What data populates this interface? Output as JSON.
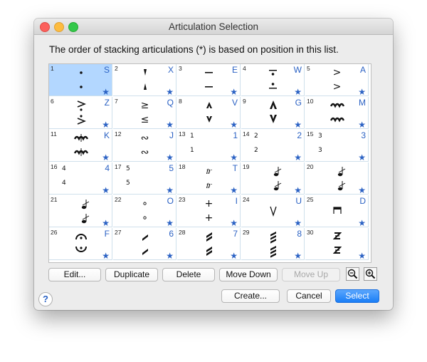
{
  "window": {
    "title": "Articulation Selection"
  },
  "instruction": "The order of stacking articulations (*) is based on position in this list.",
  "grid": {
    "star": "★",
    "cells": [
      {
        "num": "1",
        "key": "S",
        "symbol": "staccato-dot",
        "selected": true
      },
      {
        "num": "2",
        "key": "X",
        "symbol": "staccatissimo-wedge"
      },
      {
        "num": "3",
        "key": "E",
        "symbol": "tenuto-line"
      },
      {
        "num": "4",
        "key": "W",
        "symbol": "tenuto-staccato"
      },
      {
        "num": "5",
        "key": "A",
        "symbol": "accent",
        "top": ">",
        "bot": ">"
      },
      {
        "num": "6",
        "key": "Z",
        "symbol": "accent-staccato"
      },
      {
        "num": "7",
        "key": "Q",
        "symbol": "accent-tenuto",
        "top": "≥",
        "bot": "≤"
      },
      {
        "num": "8",
        "key": "V",
        "symbol": "marcato-small"
      },
      {
        "num": "9",
        "key": "G",
        "symbol": "marcato-large"
      },
      {
        "num": "10",
        "key": "M",
        "symbol": "trill-squiggle"
      },
      {
        "num": "11",
        "key": "K",
        "symbol": "mordent"
      },
      {
        "num": "12",
        "key": "J",
        "symbol": "turn",
        "top": "∾",
        "bot": "∾"
      },
      {
        "num": "13",
        "key": "1",
        "symbol": "fingering-1",
        "top": "1",
        "bot": "1"
      },
      {
        "num": "14",
        "key": "2",
        "symbol": "fingering-2",
        "top": "2",
        "bot": "2"
      },
      {
        "num": "15",
        "key": "3",
        "symbol": "fingering-3",
        "top": "3",
        "bot": "3"
      },
      {
        "num": "16",
        "key": "4",
        "symbol": "fingering-4",
        "top": "4",
        "bot": "4"
      },
      {
        "num": "17",
        "key": "5",
        "symbol": "fingering-5",
        "top": "5",
        "bot": "5"
      },
      {
        "num": "18",
        "key": "T",
        "symbol": "trill-tr",
        "top": "𝆖",
        "bot": "𝆖"
      },
      {
        "num": "19",
        "key": "",
        "symbol": "grace-note"
      },
      {
        "num": "20",
        "key": "",
        "symbol": "grace-note"
      },
      {
        "num": "21",
        "key": "",
        "symbol": "grace-note"
      },
      {
        "num": "22",
        "key": "O",
        "symbol": "harmonic-circle",
        "top": "∘",
        "bot": "∘"
      },
      {
        "num": "23",
        "key": "I",
        "symbol": "plus-stopped",
        "top": "+",
        "bot": "+"
      },
      {
        "num": "24",
        "key": "U",
        "symbol": "up-bow"
      },
      {
        "num": "25",
        "key": "D",
        "symbol": "down-bow"
      },
      {
        "num": "26",
        "key": "F",
        "symbol": "fermata"
      },
      {
        "num": "27",
        "key": "6",
        "symbol": "tremolo-1"
      },
      {
        "num": "28",
        "key": "7",
        "symbol": "tremolo-2"
      },
      {
        "num": "29",
        "key": "8",
        "symbol": "tremolo-3"
      },
      {
        "num": "30",
        "key": "",
        "symbol": "buzz-z"
      }
    ]
  },
  "buttons": {
    "edit": "Edit...",
    "duplicate": "Duplicate",
    "delete": "Delete",
    "move_down": "Move Down",
    "move_up": "Move Up",
    "create": "Create...",
    "cancel": "Cancel",
    "select": "Select"
  },
  "help_label": "?",
  "colors": {
    "accent": "#2b62c4",
    "selected": "#b3d7ff",
    "primary_button": "#1a7ef6"
  }
}
